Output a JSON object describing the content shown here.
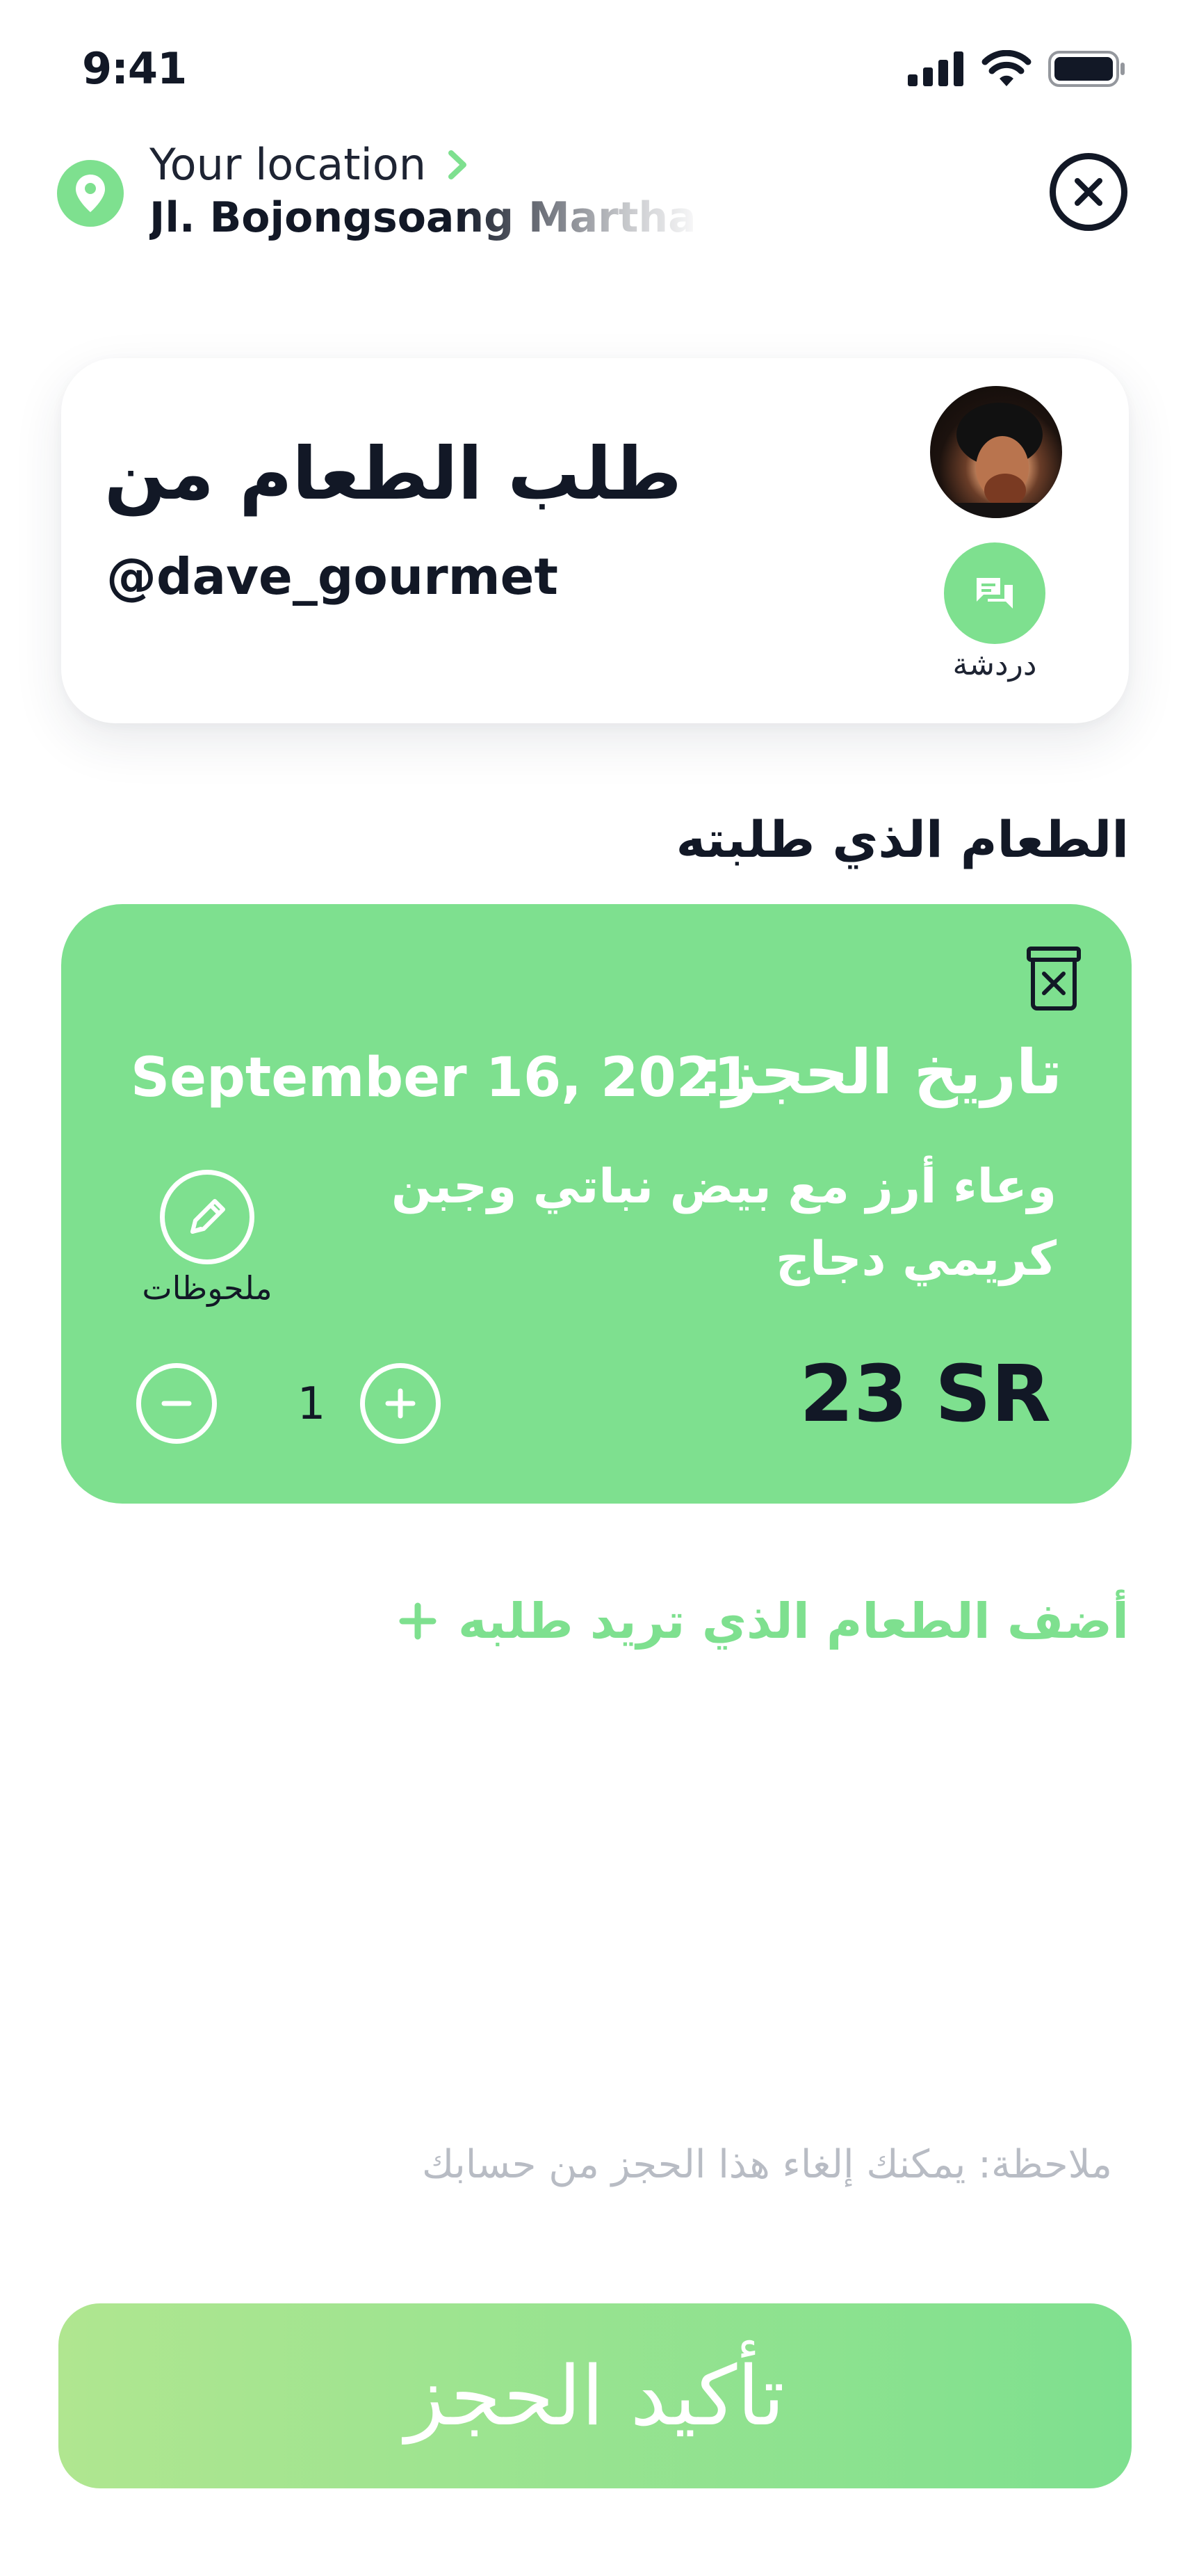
{
  "status_bar": {
    "time": "9:41",
    "icons": [
      "signal-icon",
      "wifi-icon",
      "battery-icon"
    ]
  },
  "location": {
    "label": "Your location",
    "address": "Jl. Bojongsoang Martha Reg",
    "icon": "map-pin-icon"
  },
  "chef": {
    "title": "طلب الطعام من",
    "handle": "@dave_gourmet",
    "chat_label": "دردشة"
  },
  "order": {
    "section_title": "الطعام الذي طلبته",
    "booking_label": "تاريخ الحجز:",
    "booking_date": "September 16, 2021",
    "item_name": "وعاء أرز مع بيض نباتي وجبن كريمي دجاج",
    "notes_label": "ملحوظات",
    "quantity": "1",
    "price": "23 SR"
  },
  "add_more_label": "أضف الطعام الذي تريد طلبه",
  "note": "ملاحظة: يمكنك إلغاء هذا الحجز من حسابك",
  "confirm_label": "تأكيد الحجز",
  "colors": {
    "accent": "#7EE08F",
    "accent_light": "#B0E690",
    "text_dark": "#121826",
    "muted": "#B8BCC4"
  }
}
